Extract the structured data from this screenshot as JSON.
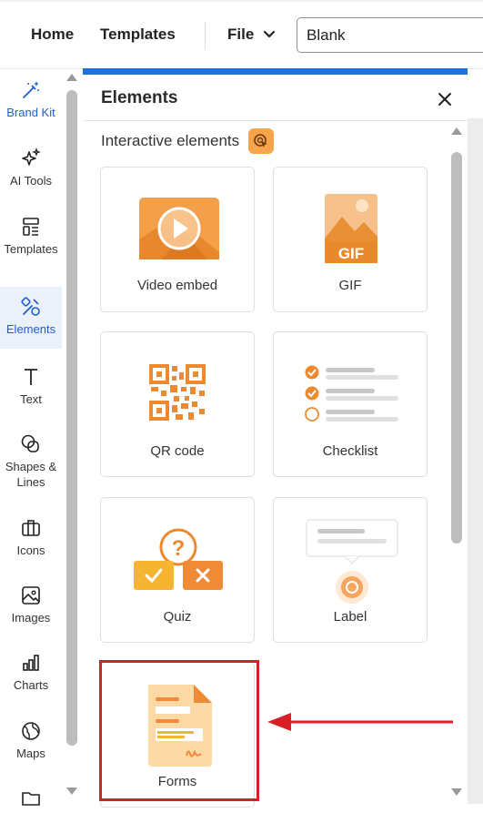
{
  "topbar": {
    "home_label": "Home",
    "templates_label": "Templates",
    "file_label": "File",
    "doc_title_value": "Blank"
  },
  "sidebar": {
    "items": [
      {
        "label": "Brand Kit",
        "icon": "magic-wand-icon"
      },
      {
        "label": "AI Tools",
        "icon": "sparkles-icon"
      },
      {
        "label": "Templates",
        "icon": "templates-icon"
      },
      {
        "label": "Elements",
        "icon": "elements-icon",
        "active": true
      },
      {
        "label": "Text",
        "icon": "text-icon"
      },
      {
        "label": "Shapes & Lines",
        "icon": "shapes-icon"
      },
      {
        "label": "Icons",
        "icon": "briefcase-icon"
      },
      {
        "label": "Images",
        "icon": "image-icon"
      },
      {
        "label": "Charts",
        "icon": "bar-chart-icon"
      },
      {
        "label": "Maps",
        "icon": "globe-icon"
      },
      {
        "label": "",
        "icon": "folder-icon"
      }
    ]
  },
  "panel": {
    "title": "Elements",
    "section_title": "Interactive elements",
    "cards": [
      {
        "label": "Video embed",
        "icon": "video-embed-icon"
      },
      {
        "label": "GIF",
        "icon": "gif-icon",
        "badge": "GIF"
      },
      {
        "label": "QR code",
        "icon": "qr-code-icon"
      },
      {
        "label": "Checklist",
        "icon": "checklist-icon"
      },
      {
        "label": "Quiz",
        "icon": "quiz-icon"
      },
      {
        "label": "Label",
        "icon": "label-icon"
      },
      {
        "label": "Forms",
        "icon": "forms-icon"
      }
    ]
  },
  "colors": {
    "accent_blue": "#1c6fe0",
    "brand_orange": "#f29a3a",
    "annotation_red": "#d81f26"
  }
}
